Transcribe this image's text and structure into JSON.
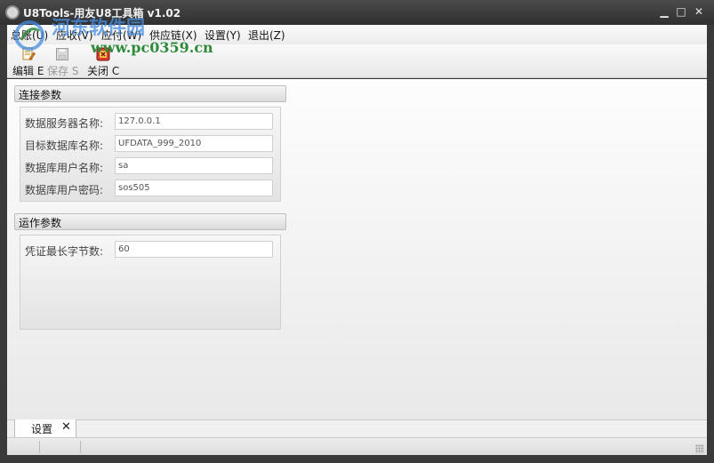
{
  "window": {
    "title": "U8Tools-用友U8工具箱 v1.02",
    "minimize_glyph": "▁",
    "maximize_glyph": "□",
    "close_glyph": "✕"
  },
  "watermark": {
    "brand": "河东软件园",
    "url": "www.pc0359.cn"
  },
  "menu": [
    "总账(U)",
    "应收(V)",
    "应付(W)",
    "供应链(X)",
    "设置(Y)",
    "退出(Z)"
  ],
  "toolbar": {
    "edit_label": "编辑 E",
    "save_label": "保存 S",
    "close_label": "关闭 C",
    "edit_icon": "edit-document-icon",
    "save_icon": "save-icon",
    "close_icon": "close-exit-icon"
  },
  "connection": {
    "title": "连接参数",
    "fields": [
      {
        "label": "数据服务器名称:",
        "value": "127.0.0.1"
      },
      {
        "label": "目标数据库名称:",
        "value": "UFDATA_999_2010"
      },
      {
        "label": "数据库用户名称:",
        "value": "sa"
      },
      {
        "label": "数据库用户密码:",
        "value": "sos505"
      }
    ]
  },
  "operation": {
    "title": "运作参数",
    "fields": [
      {
        "label": "凭证最长字节数:",
        "value": "60"
      }
    ]
  },
  "tabs": [
    {
      "label": "设置",
      "close_glyph": "✕"
    }
  ],
  "colors": {
    "titlebar": "#3a3a3a",
    "watermark_blue": "#468cdc",
    "watermark_green": "#2e8b3a"
  }
}
